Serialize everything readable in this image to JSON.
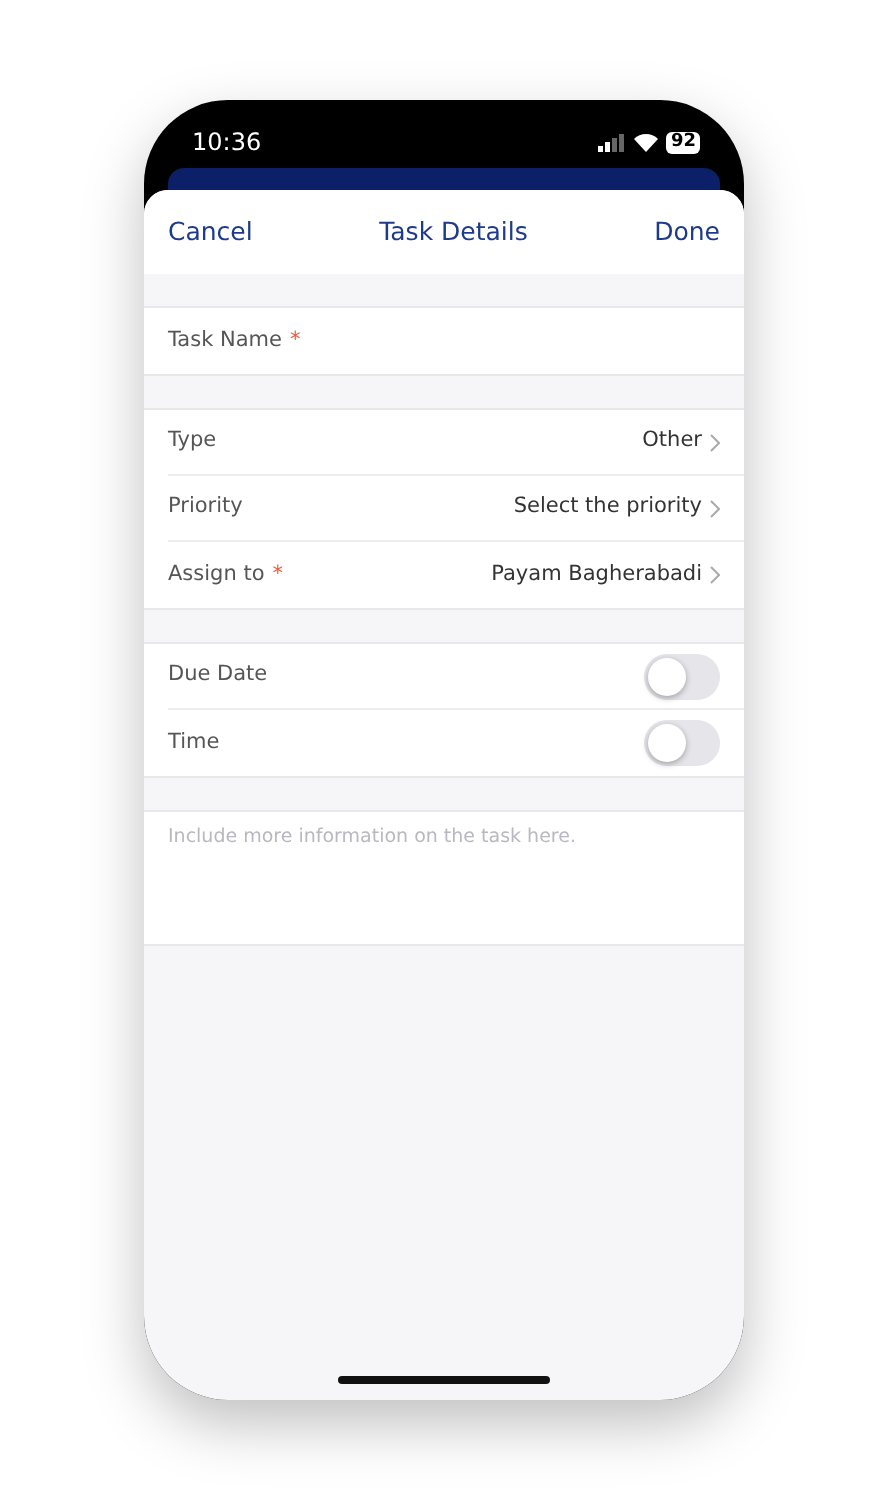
{
  "status_bar": {
    "time": "10:36",
    "battery": "92"
  },
  "header": {
    "cancel": "Cancel",
    "title": "Task Details",
    "done": "Done"
  },
  "task_name": {
    "label": "Task Name",
    "required_mark": "*"
  },
  "pickers": [
    {
      "label": "Type",
      "value": "Other"
    },
    {
      "label": "Priority",
      "value": "Select the priority"
    },
    {
      "label": "Assign to",
      "value": "Payam Bagherabadi",
      "required_mark": "*"
    }
  ],
  "toggles": [
    {
      "label": "Due Date",
      "on": false
    },
    {
      "label": "Time",
      "on": false
    }
  ],
  "notes": {
    "placeholder": "Include more information on the task here."
  }
}
